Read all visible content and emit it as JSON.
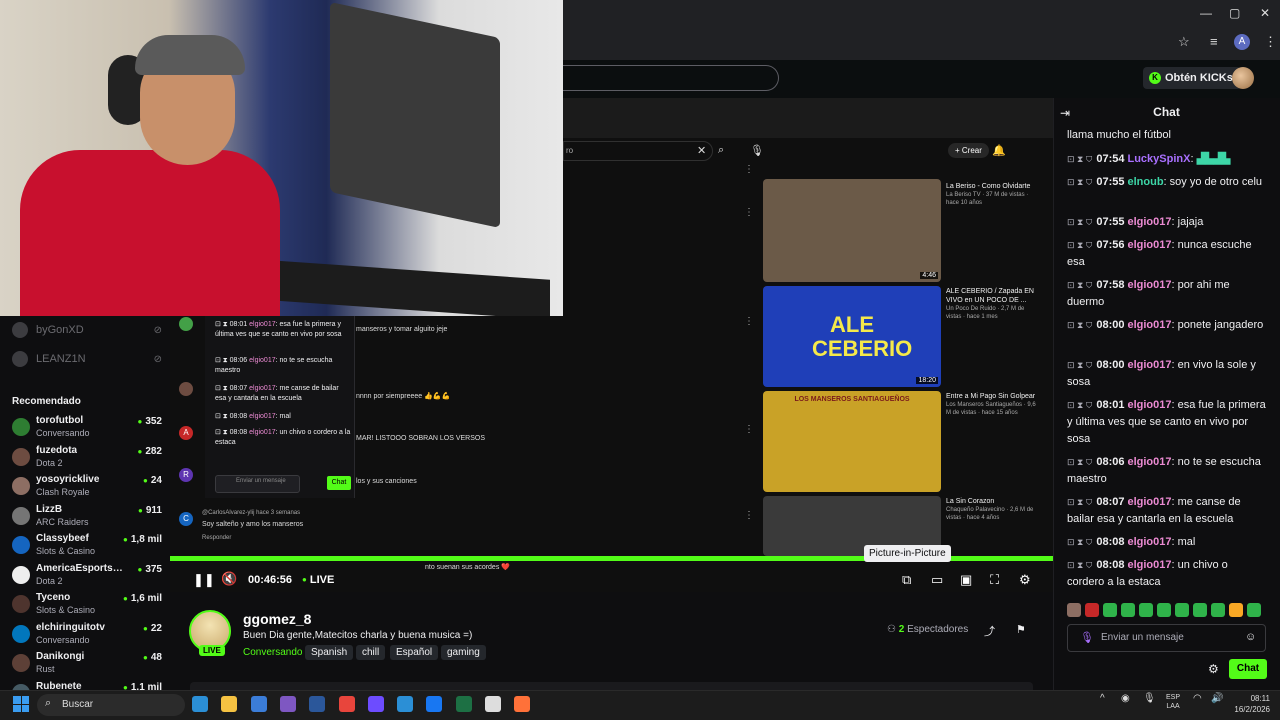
{
  "browser": {
    "window_controls": [
      "—",
      "▢",
      "✕"
    ],
    "icons": [
      "star-icon",
      "reading-list-icon",
      "profile-icon",
      "menu-icon"
    ],
    "profile_initial": "A"
  },
  "kick_header": {
    "kicks_button": "Obtén KICKs"
  },
  "sidebar": {
    "followed": [
      {
        "name": "byGonXD"
      },
      {
        "name": "LEANZ1N"
      }
    ],
    "recommended_title": "Recomendado",
    "recommended": [
      {
        "name": "torofutbol",
        "category": "Conversando",
        "viewers": "352",
        "color": "#2e7d32"
      },
      {
        "name": "fuzedota",
        "category": "Dota 2",
        "viewers": "282",
        "color": "#6d4c41"
      },
      {
        "name": "yosoyricklive",
        "category": "Clash Royale",
        "viewers": "24",
        "color": "#8d6e63"
      },
      {
        "name": "LizzB",
        "category": "ARC Raiders",
        "viewers": "911",
        "color": "#757575"
      },
      {
        "name": "Classybeef",
        "category": "Slots & Casino",
        "viewers": "1,8 mil",
        "color": "#1565c0"
      },
      {
        "name": "AmericaEsportsD...",
        "category": "Dota 2",
        "viewers": "375",
        "color": "#eeeeee"
      },
      {
        "name": "Tyceno",
        "category": "Slots & Casino",
        "viewers": "1,6 mil",
        "color": "#4e342e"
      },
      {
        "name": "elchiringuitotv",
        "category": "Conversando",
        "viewers": "22",
        "color": "#0277bd"
      },
      {
        "name": "Danikongi",
        "category": "Rust",
        "viewers": "48",
        "color": "#5d4037"
      },
      {
        "name": "Rubenete",
        "category": "",
        "viewers": "1,1 mil",
        "color": "#455a64"
      }
    ]
  },
  "embedded_youtube": {
    "create_label": "+ Crear",
    "videos": [
      {
        "title": "La Beriso - Como Olvidarte",
        "meta": "La Beriso TV · 37 M de vistas · hace 10 años",
        "duration": "4:46",
        "thumb_color": "#6b5a48"
      },
      {
        "title": "ALE CEBERIO / Zapada EN VIVO en UN POCO DE ...",
        "meta": "Un Poco De Ruido · 2,7 M de vistas · hace 1 mes",
        "duration": "18:20",
        "thumb_color": "#1f3fb8",
        "thumb_text": "ALE CEBERIO"
      },
      {
        "title": "Entre a Mi Pago Sin Golpear",
        "meta": "Los Manseros Santiagueños · 9,6 M de vistas · hace 15 años",
        "duration": "",
        "thumb_color": "#c9a227",
        "thumb_text": "LOS MANSEROS SANTIAGUEÑOS"
      },
      {
        "title": "La Sin Corazon",
        "meta": "Chaqueño Palavecino · 2,6 M de vistas · hace 4 años",
        "duration": "",
        "thumb_color": "#3a3a3a"
      }
    ],
    "comments": [
      {
        "initial": "A",
        "text": "MAR! LISTOOO SOBRAN LOS VERSOS",
        "color": "#c62828"
      },
      {
        "initial": "R",
        "text": "los y sus canciones",
        "color": "#5e35b1"
      },
      {
        "initial": "C",
        "author": "@CarlosAlvarez-ylij  hace 3 semanas",
        "text": "Soy salteño y amo los manseros",
        "reply": "Responder",
        "color": "#1565c0"
      }
    ],
    "comment_snippets": [
      "manseros y tomar alguito jeje",
      "nnnn por siempreeee 👍💪💪",
      "nto suenan sus acordes ❤️"
    ]
  },
  "mini_chat": {
    "messages": [
      {
        "time": "08:01",
        "user": "elgio017",
        "text": "esa fue la primera y última ves que se canto en vivo por sosa"
      },
      {
        "time": "08:06",
        "user": "elgio017",
        "text": "no te se escucha maestro"
      },
      {
        "time": "08:07",
        "user": "elgio017",
        "text": "me canse de bailar esa y cantarla en la escuela"
      },
      {
        "time": "08:08",
        "user": "elgio017",
        "text": "mal"
      },
      {
        "time": "08:08",
        "user": "elgio017",
        "text": "un chivo o cordero a la estaca"
      }
    ],
    "input_placeholder": "Enviar un mensaje",
    "send_label": "Chat"
  },
  "player": {
    "timecode": "00:46:56",
    "live_label": "LIVE",
    "progress": 1.0,
    "tooltip": "Picture-in-Picture"
  },
  "channel": {
    "name": "ggomez_8",
    "title": "Buen Dia gente,Matecitos charla y buena musica =)",
    "category": "Conversando",
    "live_badge": "LIVE",
    "tags": [
      "Spanish",
      "chill",
      "Español",
      "gaming"
    ],
    "viewers_count": "2",
    "viewers_label": "Espectadores"
  },
  "chat": {
    "title": "Chat",
    "messages": [
      {
        "time": "",
        "user": "",
        "color": "#efeff1",
        "text": "llama mucho el fútbol"
      },
      {
        "time": "07:54",
        "user": "LuckySpinX",
        "color": "#a970ff",
        "text": ""
      },
      {
        "time": "07:55",
        "user": "elnoub",
        "color": "#3dd6a7",
        "text": "soy yo de otro celu"
      },
      {
        "time": "07:55",
        "user": "elgio017",
        "color": "#ec8bd3",
        "text": "jajaja"
      },
      {
        "time": "07:56",
        "user": "elgio017",
        "color": "#ec8bd3",
        "text": "nunca escuche esa"
      },
      {
        "time": "07:58",
        "user": "elgio017",
        "color": "#ec8bd3",
        "text": "por ahi me duermo"
      },
      {
        "time": "08:00",
        "user": "elgio017",
        "color": "#ec8bd3",
        "text": "ponete jangadero"
      },
      {
        "time": "08:00",
        "user": "elgio017",
        "color": "#ec8bd3",
        "text": "en vivo la sole y sosa"
      },
      {
        "time": "08:01",
        "user": "elgio017",
        "color": "#ec8bd3",
        "text": "esa fue la primera y última ves que se canto en vivo por sosa"
      },
      {
        "time": "08:06",
        "user": "elgio017",
        "color": "#ec8bd3",
        "text": "no te se escucha maestro"
      },
      {
        "time": "08:07",
        "user": "elgio017",
        "color": "#ec8bd3",
        "text": "me canse de bailar esa y cantarla en la escuela"
      },
      {
        "time": "08:08",
        "user": "elgio017",
        "color": "#ec8bd3",
        "text": "mal"
      },
      {
        "time": "08:08",
        "user": "elgio017",
        "color": "#ec8bd3",
        "text": "un chivo o cordero a la estaca"
      }
    ],
    "input_placeholder": "Enviar un mensaje",
    "send_label": "Chat"
  },
  "taskbar": {
    "search_label": "Buscar",
    "language": "ESP",
    "layout": "LAA",
    "time": "08:11",
    "date": "16/2/2026",
    "apps": [
      "edge-icon",
      "file-explorer-icon",
      "store-icon",
      "app-icon",
      "word-icon",
      "chrome-icon",
      "app-icon",
      "app-icon",
      "facebook-icon",
      "excel-icon",
      "app-icon",
      "firefox-icon"
    ]
  }
}
